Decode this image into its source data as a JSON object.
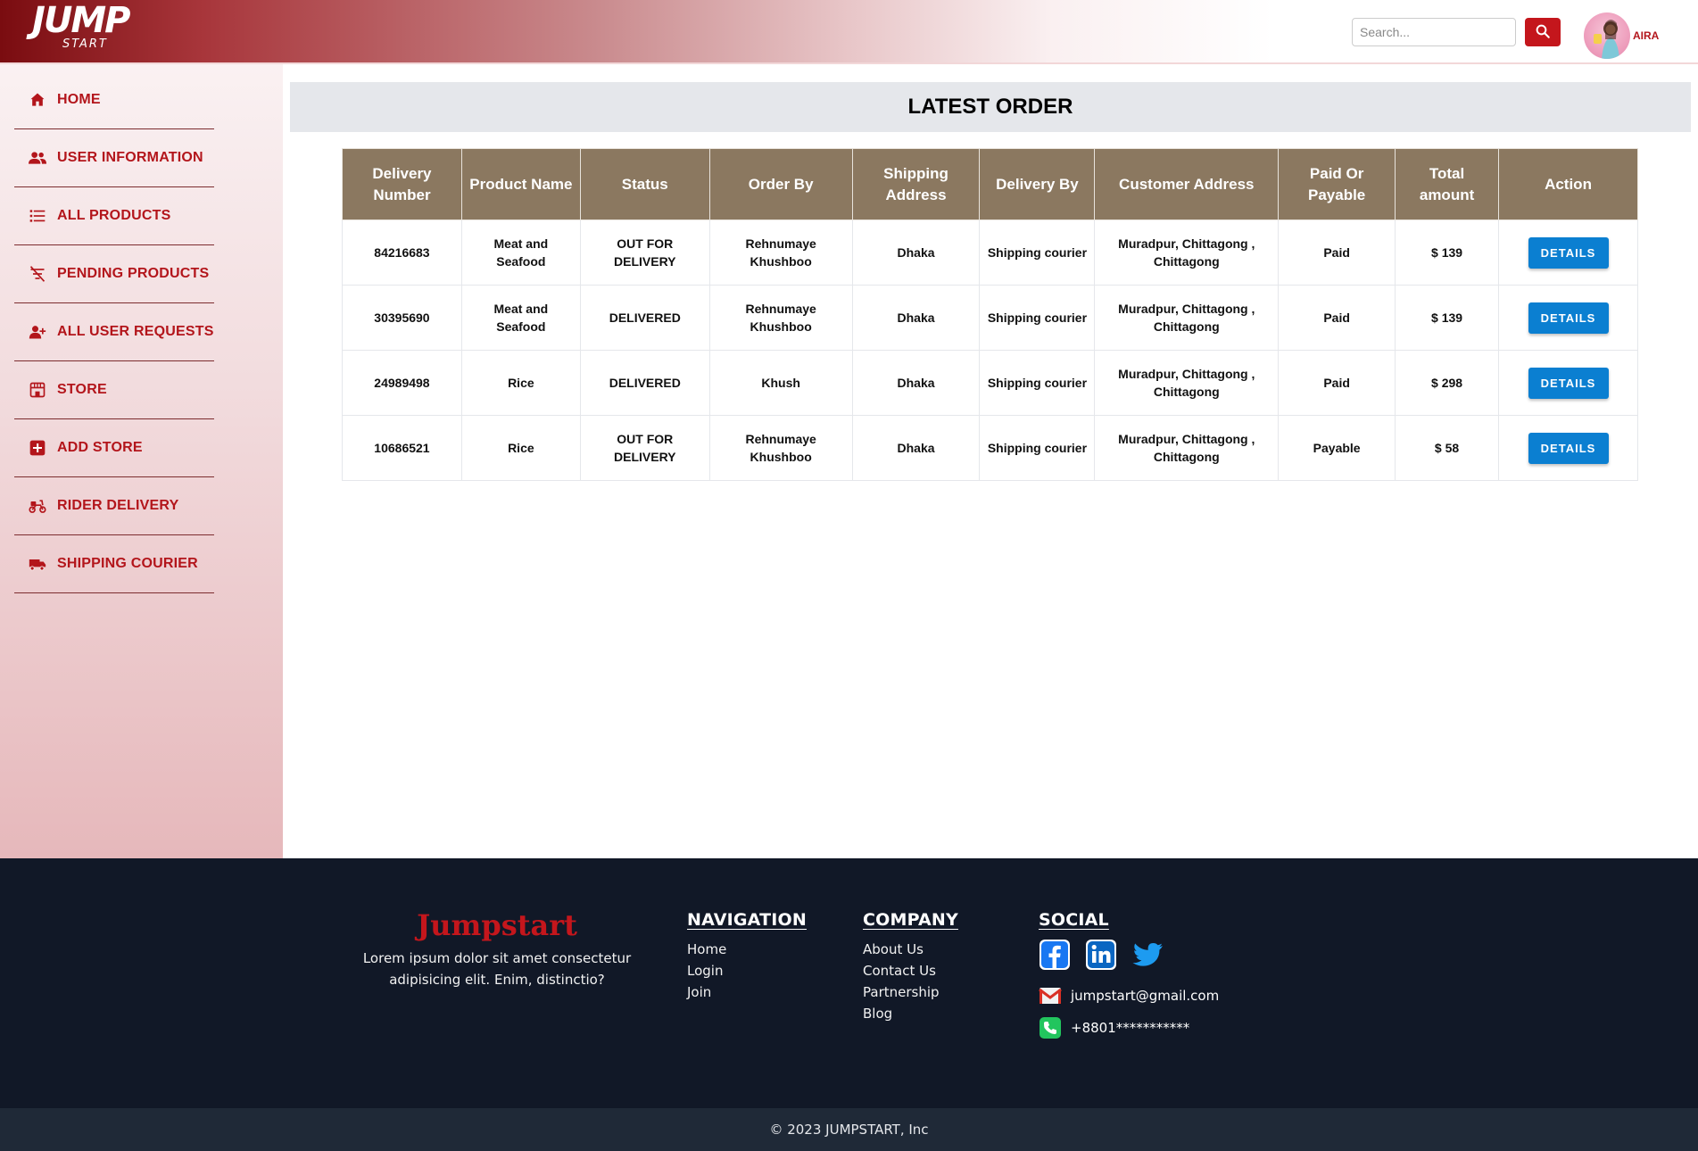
{
  "header": {
    "logo_main": "JUMP",
    "logo_sub": "START",
    "search_placeholder": "Search...",
    "user_name": "AIRA"
  },
  "sidebar": {
    "items": [
      {
        "label": "HOME",
        "icon": "home-icon"
      },
      {
        "label": "USER INFORMATION",
        "icon": "users-icon"
      },
      {
        "label": "ALL PRODUCTS",
        "icon": "list-icon"
      },
      {
        "label": "PENDING PRODUCTS",
        "icon": "filter-off-icon"
      },
      {
        "label": "ALL USER REQUESTS",
        "icon": "user-plus-icon"
      },
      {
        "label": "STORE",
        "icon": "store-icon"
      },
      {
        "label": "ADD STORE",
        "icon": "plus-square-icon"
      },
      {
        "label": "RIDER DELIVERY",
        "icon": "scooter-icon"
      },
      {
        "label": "SHIPPING COURIER",
        "icon": "truck-icon"
      }
    ]
  },
  "main": {
    "title": "LATEST ORDER",
    "columns": [
      "Delivery Number",
      "Product Name",
      "Status",
      "Order By",
      "Shipping Address",
      "Delivery By",
      "Customer Address",
      "Paid Or Payable",
      "Total amount",
      "Action"
    ],
    "rows": [
      {
        "delivery_number": "84216683",
        "product": "Meat and Seafood",
        "status": "OUT FOR DELIVERY",
        "order_by": "Rehnumaye Khushboo",
        "shipping_address": "Dhaka",
        "delivery_by": "Shipping courier",
        "customer_address": "Muradpur, Chittagong , Chittagong",
        "paid": "Paid",
        "total": "$ 139",
        "action": "DETAILS"
      },
      {
        "delivery_number": "30395690",
        "product": "Meat and Seafood",
        "status": "DELIVERED",
        "order_by": "Rehnumaye Khushboo",
        "shipping_address": "Dhaka",
        "delivery_by": "Shipping courier",
        "customer_address": "Muradpur, Chittagong , Chittagong",
        "paid": "Paid",
        "total": "$ 139",
        "action": "DETAILS"
      },
      {
        "delivery_number": "24989498",
        "product": "Rice",
        "status": "DELIVERED",
        "order_by": "Khush",
        "shipping_address": "Dhaka",
        "delivery_by": "Shipping courier",
        "customer_address": "Muradpur, Chittagong , Chittagong",
        "paid": "Paid",
        "total": "$ 298",
        "action": "DETAILS"
      },
      {
        "delivery_number": "10686521",
        "product": "Rice",
        "status": "OUT FOR DELIVERY",
        "order_by": "Rehnumaye Khushboo",
        "shipping_address": "Dhaka",
        "delivery_by": "Shipping courier",
        "customer_address": "Muradpur, Chittagong , Chittagong",
        "paid": "Payable",
        "total": "$ 58",
        "action": "DETAILS"
      }
    ]
  },
  "footer": {
    "brand_name": "Jumpstart",
    "brand_desc": "Lorem ipsum dolor sit amet consectetur adipisicing elit. Enim, distinctio?",
    "navigation": {
      "title": "NAVIGATION",
      "links": [
        "Home",
        "Login",
        "Join"
      ]
    },
    "company": {
      "title": "COMPANY",
      "links": [
        "About Us",
        "Contact Us",
        "Partnership",
        "Blog"
      ]
    },
    "social": {
      "title": "SOCIAL",
      "email": "jumpstart@gmail.com",
      "phone": "+8801***********"
    },
    "copyright": "© 2023 JUMPSTART, Inc"
  },
  "colors": {
    "brand_red": "#b3151b",
    "table_header": "#8b7860",
    "details_button": "#0b7fd1",
    "status_out": "#b26a00",
    "status_delivered": "#15803d",
    "footer_bg": "#111827"
  }
}
